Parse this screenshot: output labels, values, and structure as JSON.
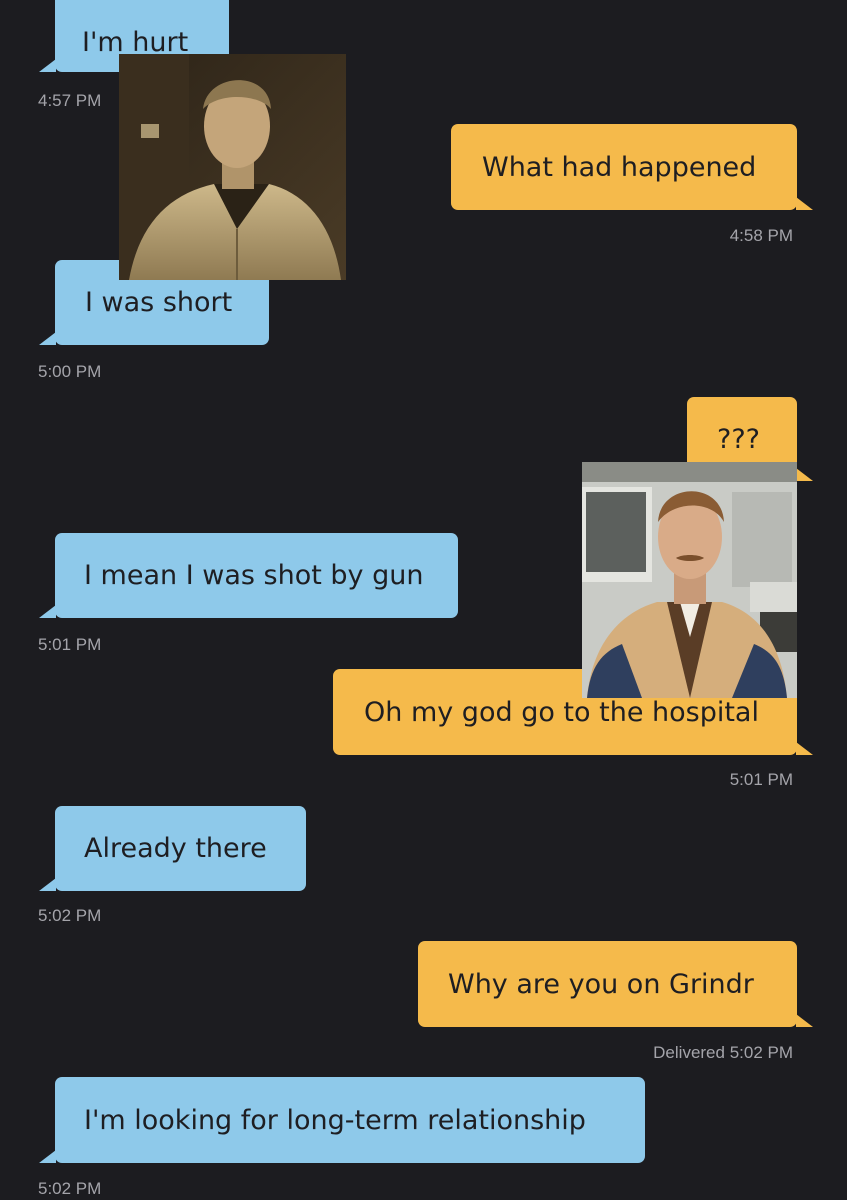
{
  "messages": [
    {
      "dir": "in",
      "text": "I'm hurt",
      "time": "4:57 PM"
    },
    {
      "dir": "out",
      "text": "What had happened",
      "time": "4:58 PM"
    },
    {
      "dir": "in",
      "text": "I was short",
      "time": "5:00 PM"
    },
    {
      "dir": "out",
      "text": "???",
      "time": ""
    },
    {
      "dir": "in",
      "text": "I mean I was shot by gun",
      "time": "5:01 PM"
    },
    {
      "dir": "out",
      "text": "Oh my god go to the hospital",
      "time": "5:01 PM"
    },
    {
      "dir": "in",
      "text": "Already there",
      "time": "5:02 PM"
    },
    {
      "dir": "out",
      "text": "Why are you on Grindr",
      "time": "Delivered 5:02 PM"
    },
    {
      "dir": "in",
      "text": "I'm looking for long-term relationship",
      "time": "5:02 PM"
    }
  ],
  "colors": {
    "background": "#1c1c20",
    "incoming_bubble": "#8ec9ea",
    "outgoing_bubble": "#f5ba4b",
    "timestamp": "#a4a4aa"
  }
}
